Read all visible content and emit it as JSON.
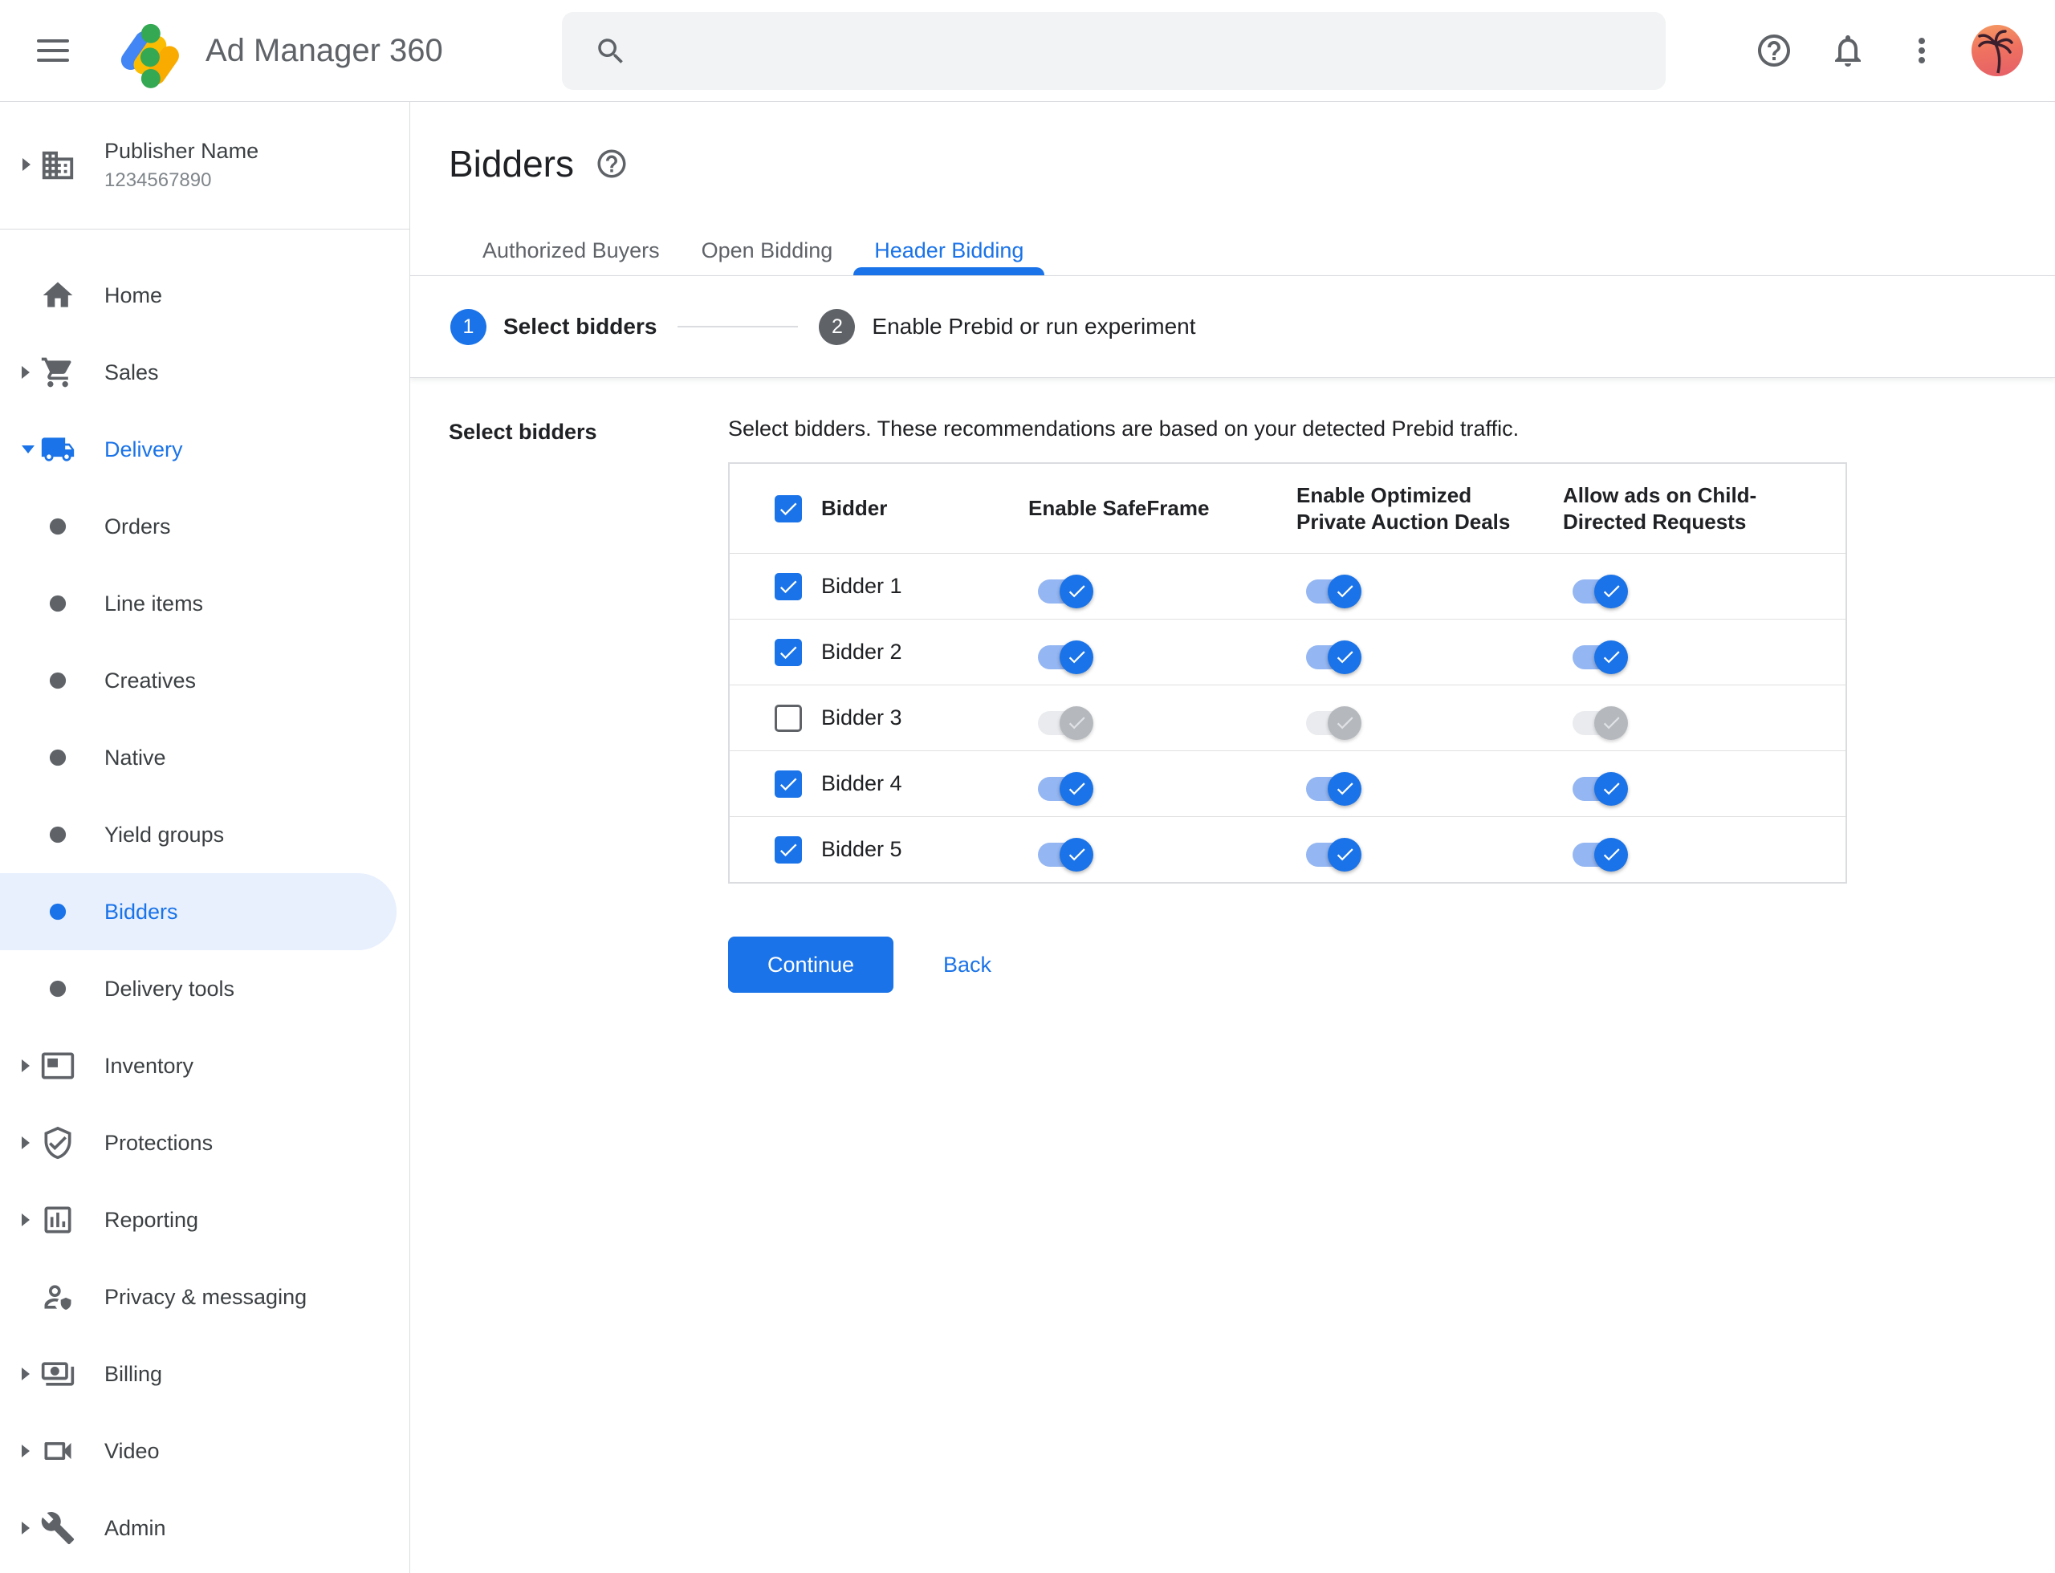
{
  "topbar": {
    "product_name": "Ad Manager 360",
    "search": {
      "placeholder": "",
      "value": ""
    },
    "icons": [
      "menu-icon",
      "search-icon",
      "help-icon",
      "bell-icon",
      "more-vertical-icon",
      "avatar"
    ]
  },
  "sidebar": {
    "publisher": {
      "name": "Publisher Name",
      "id": "1234567890"
    },
    "items": [
      {
        "label": "Home",
        "icon": "home"
      },
      {
        "label": "Sales",
        "icon": "cart",
        "expandable": true
      },
      {
        "label": "Delivery",
        "icon": "truck",
        "expanded": true,
        "highlight": true
      },
      {
        "label": "Orders",
        "sub": true
      },
      {
        "label": "Line items",
        "sub": true
      },
      {
        "label": "Creatives",
        "sub": true
      },
      {
        "label": "Native",
        "sub": true
      },
      {
        "label": "Yield groups",
        "sub": true
      },
      {
        "label": "Bidders",
        "sub": true,
        "selected": true
      },
      {
        "label": "Delivery tools",
        "sub": true
      },
      {
        "label": "Inventory",
        "icon": "featured-video",
        "expandable": true
      },
      {
        "label": "Protections",
        "icon": "shield",
        "expandable": true
      },
      {
        "label": "Reporting",
        "icon": "chart",
        "expandable": true
      },
      {
        "label": "Privacy & messaging",
        "icon": "privacy"
      },
      {
        "label": "Billing",
        "icon": "payments",
        "expandable": true
      },
      {
        "label": "Video",
        "icon": "videocam",
        "expandable": true
      },
      {
        "label": "Admin",
        "icon": "wrench",
        "expandable": true
      }
    ]
  },
  "page": {
    "title": "Bidders",
    "tabs": [
      {
        "label": "Authorized Buyers",
        "active": false
      },
      {
        "label": "Open Bidding",
        "active": false
      },
      {
        "label": "Header Bidding",
        "active": true
      }
    ],
    "steps": [
      {
        "number": "1",
        "label": "Select bidders",
        "state": "current"
      },
      {
        "number": "2",
        "label": "Enable Prebid or run experiment",
        "state": "upcoming"
      }
    ]
  },
  "form": {
    "section_label": "Select bidders",
    "description": "Select bidders. These recommendations are based on your detected Prebid traffic.",
    "table": {
      "header_checkbox_checked": true,
      "columns": [
        "Bidder",
        "Enable SafeFrame",
        "Enable Optimized Private Auction Deals",
        "Allow ads on Child-Directed Requests"
      ],
      "rows": [
        {
          "name": "Bidder 1",
          "selected": true,
          "toggles": {
            "safeframe": true,
            "optimized": true,
            "child_directed": true
          }
        },
        {
          "name": "Bidder 2",
          "selected": true,
          "toggles": {
            "safeframe": true,
            "optimized": true,
            "child_directed": true
          }
        },
        {
          "name": "Bidder 3",
          "selected": false,
          "toggles": {
            "safeframe": true,
            "optimized": true,
            "child_directed": true
          }
        },
        {
          "name": "Bidder 4",
          "selected": true,
          "toggles": {
            "safeframe": true,
            "optimized": true,
            "child_directed": true
          }
        },
        {
          "name": "Bidder 5",
          "selected": true,
          "toggles": {
            "safeframe": true,
            "optimized": true,
            "child_directed": true
          }
        }
      ]
    },
    "actions": {
      "continue_label": "Continue",
      "back_label": "Back"
    }
  },
  "colors": {
    "accent": "#1a73e8",
    "toggle_track_on": "#94b6f2",
    "toggle_disabled_track": "#e9ebee",
    "toggle_disabled_thumb": "#b5b9bd",
    "selected_item_bg": "#e8f0fe",
    "border": "#dadce0",
    "row_border": "#e0e0e0",
    "text": "#202124",
    "muted_text": "#5f6368",
    "logo_blue": "#4285f4",
    "logo_yellow": "#fbbc04",
    "logo_orange": "#f9ab00",
    "logo_green": "#34a853"
  }
}
